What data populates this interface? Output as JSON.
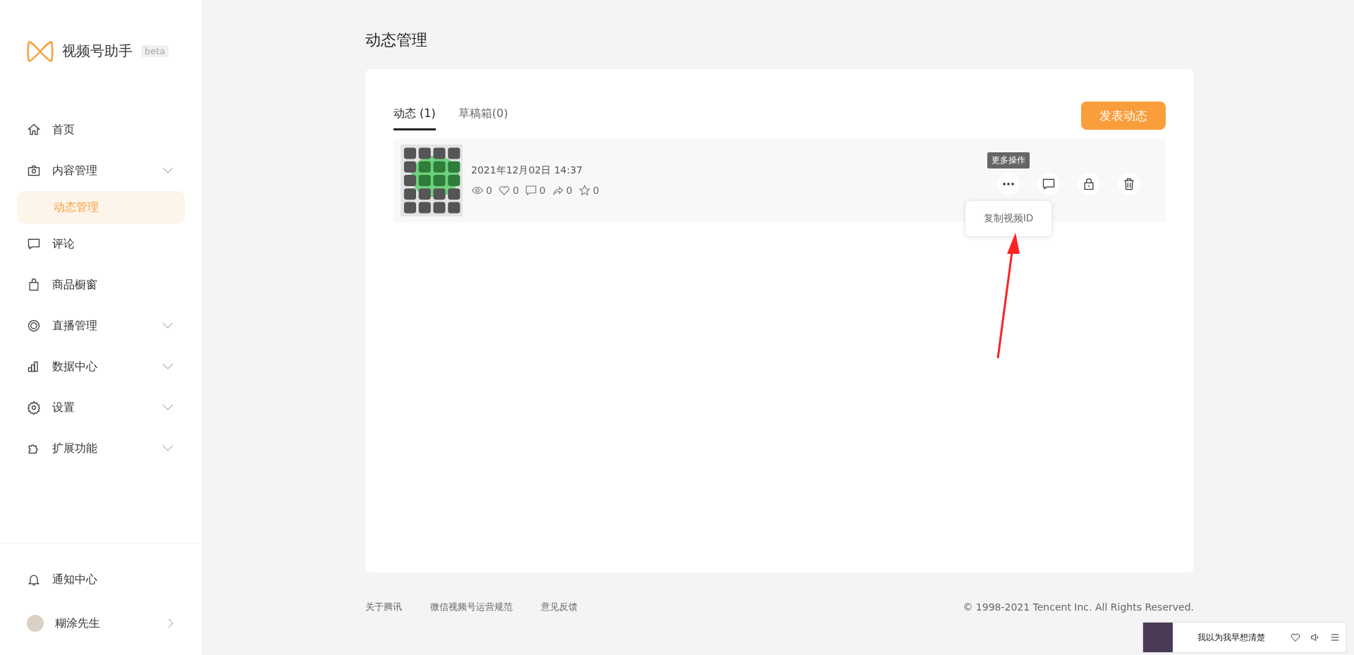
{
  "app": {
    "name": "视频号助手",
    "badge": "beta"
  },
  "nav": [
    {
      "label": "首页",
      "expandable": false,
      "selected": false
    },
    {
      "label": "内容管理",
      "expandable": true,
      "selected": false,
      "children": [
        {
          "label": "动态管理",
          "selected": true
        }
      ]
    },
    {
      "label": "评论",
      "expandable": false,
      "selected": false
    },
    {
      "label": "商品橱窗",
      "expandable": false,
      "selected": false
    },
    {
      "label": "直播管理",
      "expandable": true,
      "selected": false
    },
    {
      "label": "数据中心",
      "expandable": true,
      "selected": false
    },
    {
      "label": "设置",
      "expandable": true,
      "selected": false
    },
    {
      "label": "扩展功能",
      "expandable": true,
      "selected": false
    }
  ],
  "notifications": {
    "label": "通知中心"
  },
  "user": {
    "name": "糊涂先生"
  },
  "page_title": "动态管理",
  "tabs": [
    {
      "label": "动态 (1)",
      "selected": true
    },
    {
      "label": "草稿箱(0)",
      "selected": false
    }
  ],
  "publish_button": "发表动态",
  "posts": [
    {
      "date": "2021年12月02日 14:37",
      "stats": [
        {
          "kind": "views",
          "value": "0"
        },
        {
          "kind": "likes",
          "value": "0"
        },
        {
          "kind": "comments",
          "value": "0"
        },
        {
          "kind": "shares",
          "value": "0"
        },
        {
          "kind": "favorites",
          "value": "0"
        }
      ],
      "tooltip": "更多操作",
      "menu": [
        "复制视频ID"
      ]
    }
  ],
  "footer": {
    "links": [
      "关于腾讯",
      "微信视频号运营规范",
      "意见反馈"
    ],
    "copyright": "© 1998-2021 Tencent Inc. All Rights Reserved."
  },
  "player": {
    "title": "我以为我早想清楚"
  }
}
